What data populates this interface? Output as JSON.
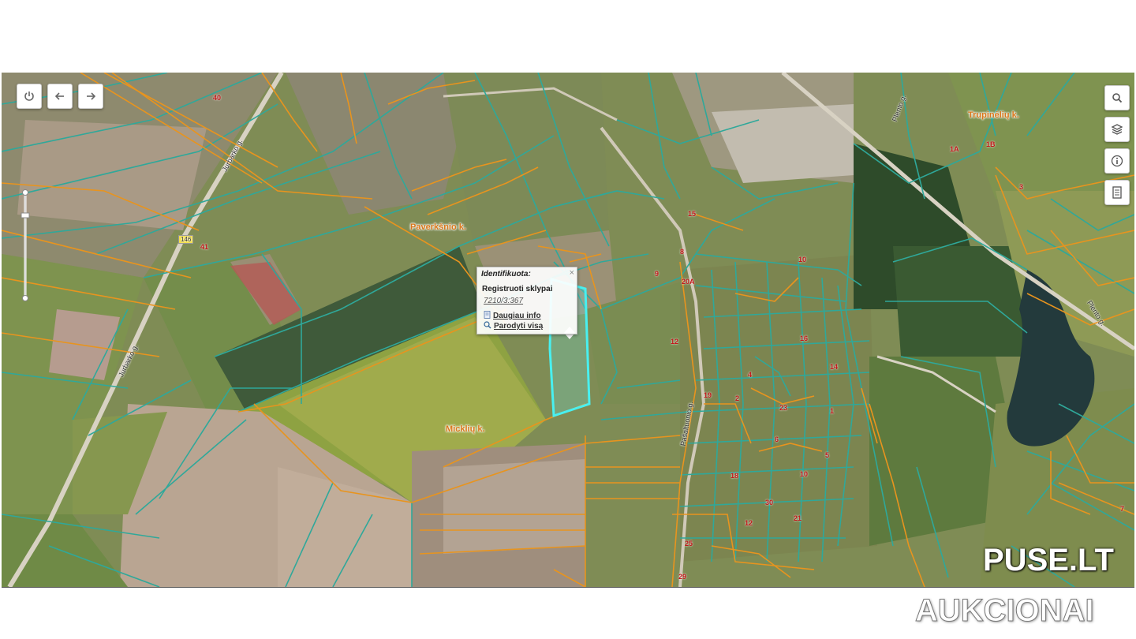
{
  "toolbar": {
    "power_icon": "power-icon",
    "back_icon": "arrow-left-icon",
    "forward_icon": "arrow-right-icon"
  },
  "right_tools": [
    "search-icon",
    "layers-icon",
    "info-icon",
    "document-icon"
  ],
  "places": {
    "payerksnio": "Paverkšnio k.",
    "mickliu": "Micklių k.",
    "trupineliu": "Trupinėlių k."
  },
  "streets": {
    "jurbarko_top": "Jurbarko g.",
    "jurbarko_bottom": "Jurbarko g.",
    "plento": "Plento g.",
    "plento2": "Plento g.",
    "rasaldes": "Pašaltuonio g.",
    "road_number": "146"
  },
  "house_numbers": [
    "40",
    "41",
    "9",
    "12",
    "15",
    "8",
    "20A",
    "1A",
    "1B",
    "3",
    "10",
    "16",
    "4",
    "14",
    "2",
    "23",
    "19",
    "25",
    "1",
    "6",
    "5",
    "21",
    "18",
    "30",
    "10",
    "12",
    "29",
    "7"
  ],
  "popup": {
    "title": "Identifikuota:",
    "close": "×",
    "layer": "Registruoti sklypai",
    "parcel_id": "7210/3:367",
    "more_info": "Daugiau info",
    "show_all": "Parodyti visą"
  },
  "watermark": {
    "line1": "PUSE.LT",
    "line2": "AUKCIONAI"
  },
  "colors": {
    "cadastre_teal": "#2fa89a",
    "cadastre_orange": "#e8941e",
    "selected": "#48f0f0"
  }
}
